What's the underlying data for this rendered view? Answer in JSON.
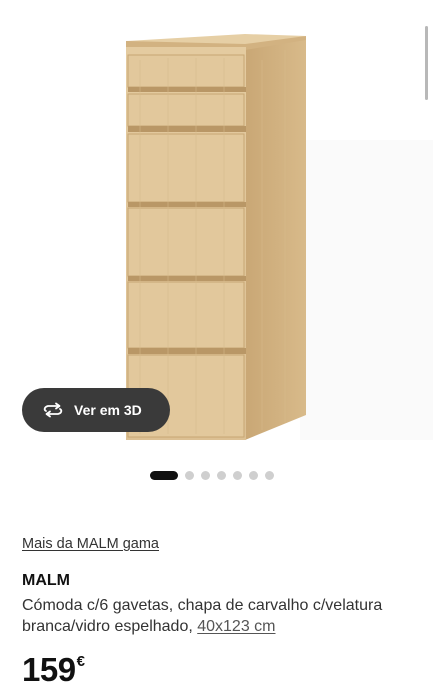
{
  "gallery": {
    "image_name": "MALM chest of 6 drawers, white stained oak veneer",
    "view3d_label": "Ver em 3D",
    "view3d_icon": "rotate-3d-icon",
    "pager": {
      "total": 7,
      "active_index": 0
    }
  },
  "product": {
    "range_link": "Mais da MALM gama",
    "name": "MALM",
    "description": "Cómoda c/6 gavetas, chapa de carvalho c/velatura branca/vidro espelhado,",
    "size": "40x123 cm",
    "price": "159",
    "currency": "€"
  },
  "colors": {
    "wood_light": "#e0c497",
    "wood_mid": "#d4b585",
    "wood_dark": "#c09e6d",
    "button_bg": "#3a3a3a",
    "dot_inactive": "#cfcfcf",
    "dot_active": "#111111"
  }
}
